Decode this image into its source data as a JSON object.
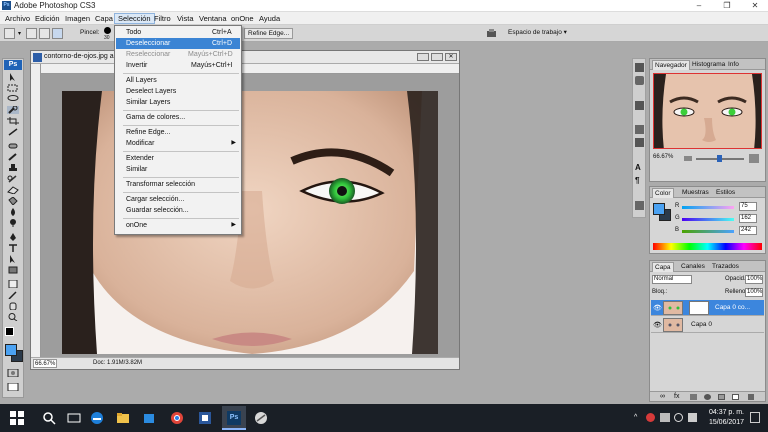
{
  "titlebar": {
    "app_icon": "Ps",
    "title": "Adobe Photoshop CS3",
    "minimize_label": "–",
    "maximize_label": "❐",
    "close_label": "✕"
  },
  "menubar": {
    "items": [
      "Archivo",
      "Edición",
      "Imagen",
      "Capa",
      "Selección",
      "Filtro",
      "Vista",
      "Ventana",
      "onOne",
      "Ayuda"
    ]
  },
  "options": {
    "brush_label": "Pincel:",
    "brush_size": "30",
    "refine_edge": "Refine Edge...",
    "workspace_label": "Espacio de trabajo"
  },
  "dropdown": {
    "items": [
      {
        "label": "Todo",
        "shortcut": "Ctrl+A",
        "state": "normal"
      },
      {
        "label": "Deseleccionar",
        "shortcut": "Ctrl+D",
        "state": "highlighted"
      },
      {
        "label": "Reseleccionar",
        "shortcut": "Mayús+Ctrl+D",
        "state": "disabled"
      },
      {
        "label": "Invertir",
        "shortcut": "Mayús+Ctrl+I",
        "state": "normal"
      },
      {
        "label": "All Layers",
        "shortcut": "",
        "state": "normal"
      },
      {
        "label": "Deselect Layers",
        "shortcut": "",
        "state": "normal"
      },
      {
        "label": "Similar Layers",
        "shortcut": "",
        "state": "normal"
      },
      {
        "label": "Gama de colores...",
        "shortcut": "",
        "state": "normal"
      },
      {
        "label": "Refine Edge...",
        "shortcut": "",
        "state": "normal"
      },
      {
        "label": "Modificar",
        "shortcut": "",
        "state": "submenu"
      },
      {
        "label": "Extender",
        "shortcut": "",
        "state": "normal"
      },
      {
        "label": "Similar",
        "shortcut": "",
        "state": "normal"
      },
      {
        "label": "Transformar selección",
        "shortcut": "",
        "state": "normal"
      },
      {
        "label": "Cargar selección...",
        "shortcut": "",
        "state": "normal"
      },
      {
        "label": "Guardar selección...",
        "shortcut": "",
        "state": "normal"
      },
      {
        "label": "onOne",
        "shortcut": "",
        "state": "submenu"
      }
    ]
  },
  "document": {
    "title": "contorno-de-ojos.jpg al",
    "zoom": "66.67%",
    "doc_info": "Doc: 1.91M/3.82M"
  },
  "navigator": {
    "tabs": [
      "Navegador",
      "Histograma",
      "Info"
    ],
    "zoom": "66.67%"
  },
  "color_panel": {
    "tabs": [
      "Color",
      "Muestras",
      "Estilos"
    ],
    "r_label": "R",
    "r_value": "75",
    "g_label": "G",
    "g_value": "162",
    "b_label": "B",
    "b_value": "242",
    "colors": {
      "foreground": "#4ba2f2"
    }
  },
  "layers_panel": {
    "tabs": [
      "Capa",
      "Canales",
      "Trazados"
    ],
    "blend_mode": "Normal",
    "opacity_label": "Opacid.:",
    "opacity": "100%",
    "lock_label": "Bloq.:",
    "fill_label": "Relleno:",
    "fill": "100%",
    "layers": [
      {
        "name": "Capa 0 co...",
        "selected": true
      },
      {
        "name": "Capa 0",
        "selected": false
      }
    ]
  },
  "taskbar": {
    "time": "04:37 p. m.",
    "date": "15/06/2017",
    "ps_icon_label": "Ps"
  }
}
